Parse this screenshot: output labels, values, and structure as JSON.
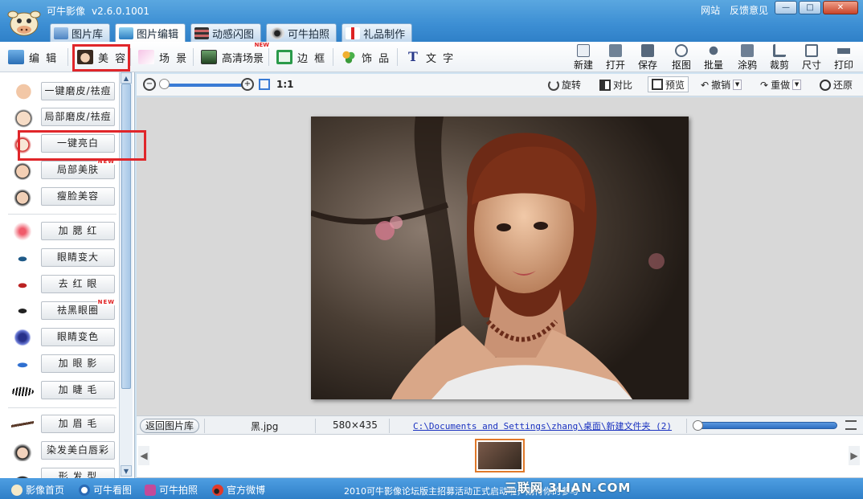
{
  "app": {
    "title": "可牛影像",
    "version": "v2.6.0.1001",
    "top_links": [
      "网站",
      "反馈意见"
    ],
    "window_controls": [
      "—",
      "□",
      "✕"
    ]
  },
  "main_tabs": [
    {
      "label": "图片库",
      "icon": "gallery-icon"
    },
    {
      "label": "图片编辑",
      "icon": "image-edit-icon",
      "active": true
    },
    {
      "label": "动感闪图",
      "icon": "animation-icon"
    },
    {
      "label": "可牛拍照",
      "icon": "webcam-icon"
    },
    {
      "label": "礼品制作",
      "icon": "gift-icon"
    }
  ],
  "sub_tabs": [
    {
      "label": "编 辑",
      "icon": "edit-icon"
    },
    {
      "label": "美 容",
      "icon": "beauty-face-icon",
      "active": true
    },
    {
      "label": "场 景",
      "icon": "scene-icon"
    },
    {
      "label": "高清场景",
      "icon": "hd-scene-icon",
      "badge": "NEW"
    },
    {
      "label": "边 框",
      "icon": "frame-icon"
    },
    {
      "label": "饰 品",
      "icon": "clover-icon"
    },
    {
      "label": "文 字",
      "icon": "text-icon"
    }
  ],
  "tools": [
    "新建",
    "打开",
    "保存",
    "抠图",
    "批量",
    "涂鸦",
    "裁剪",
    "尺寸",
    "打印"
  ],
  "left_panel": {
    "items": [
      {
        "label": "一键磨皮/祛痘"
      },
      {
        "label": "局部磨皮/祛痘"
      },
      {
        "label": "一键亮白",
        "highlighted": true
      },
      {
        "label": "局部美肤",
        "badge": "NEW"
      },
      {
        "label": "瘦脸美容"
      },
      {
        "label": "加 腮 红"
      },
      {
        "label": "眼睛变大"
      },
      {
        "label": "去 红 眼"
      },
      {
        "label": "祛黑眼圈",
        "badge": "NEW"
      },
      {
        "label": "眼睛变色"
      },
      {
        "label": "加 眼 影"
      },
      {
        "label": "加 睫 毛"
      },
      {
        "label": "加 眉 毛"
      },
      {
        "label": "染发美白唇彩"
      },
      {
        "label": "形 发 型"
      }
    ]
  },
  "image_toolbar": {
    "zoom_label": "1:1",
    "zoom_level": 0.0,
    "actions": [
      "旋转",
      "对比",
      "预览",
      "撤销",
      "重做",
      "还原"
    ]
  },
  "status": {
    "back_label": "返回图片库",
    "filename": "黑.jpg",
    "dimensions": "580×435",
    "path": "C:\\Documents and Settings\\zhang\\桌面\\新建文件夹 (2)"
  },
  "bottom": {
    "links": [
      "影像首页",
      "可牛看图",
      "可牛拍照",
      "官方微博"
    ],
    "notice": "2010可牛影像论坛版主招募活动正式启动啦，期待你的参与",
    "watermark": "三联网 3LIAN.COM"
  },
  "colors": {
    "titlebar": "#3c8ed3",
    "highlight": "#e0262a",
    "accent": "#3a7bd5"
  }
}
